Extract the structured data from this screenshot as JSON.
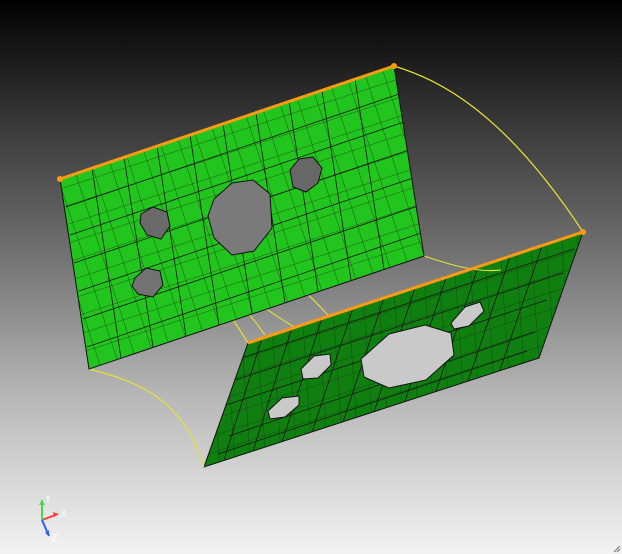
{
  "viewport": {
    "background_top": "#000000",
    "background_bottom": "#f3f3f3"
  },
  "model": {
    "front_panel_color": "#22c51d",
    "back_panel_color": "#0f7f10",
    "mesh_line_color": "#111111",
    "curve_color": "#e6e234",
    "edge_highlight_color": "#ff9a13"
  },
  "axis_triad": {
    "x_label": "X",
    "y_label": "Y",
    "z_label": "Z",
    "x_color": "#ff3b30",
    "y_color": "#48d84a",
    "z_color": "#2f5cff"
  },
  "icons": {
    "resize_grip": "resize-grip-icon"
  }
}
